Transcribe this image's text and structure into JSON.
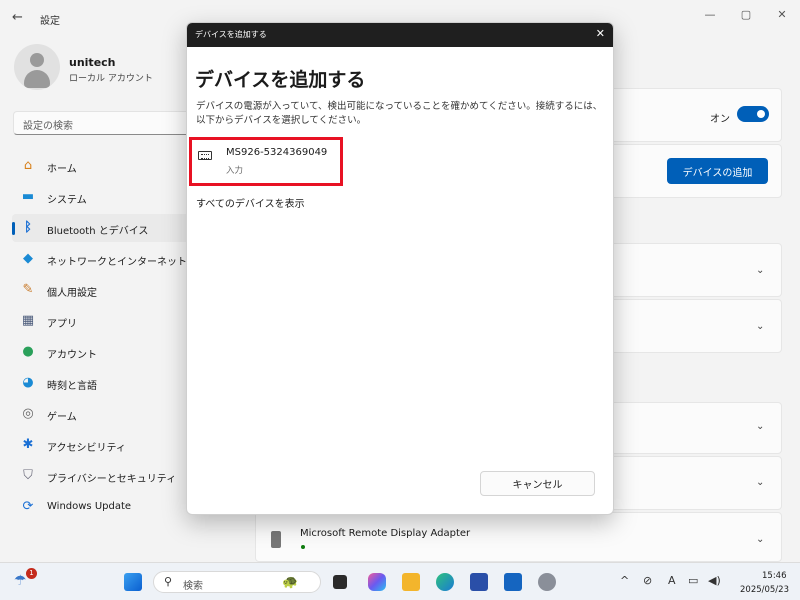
{
  "app": {
    "title": "設定",
    "window_controls": [
      "—",
      "▢",
      "✕"
    ]
  },
  "profile": {
    "name": "unitech",
    "account_type": "ローカル アカウント"
  },
  "search": {
    "placeholder": "設定の検索"
  },
  "sidebar": {
    "items": [
      {
        "label": "ホーム",
        "icon": "home-icon",
        "glyph": "⌂",
        "color": "#d7801a"
      },
      {
        "label": "システム",
        "icon": "system-icon",
        "glyph": "▬",
        "color": "#1a8ad4"
      },
      {
        "label": "Bluetooth とデバイス",
        "icon": "bluetooth-icon",
        "glyph": "ᛒ",
        "color": "#1a6fd4",
        "active": true
      },
      {
        "label": "ネットワークとインターネット",
        "icon": "network-icon",
        "glyph": "◆",
        "color": "#1a8ad4"
      },
      {
        "label": "個人用設定",
        "icon": "brush-icon",
        "glyph": "✎",
        "color": "#c87a2a"
      },
      {
        "label": "アプリ",
        "icon": "apps-icon",
        "glyph": "▦",
        "color": "#4a5a7a"
      },
      {
        "label": "アカウント",
        "icon": "account-icon",
        "glyph": "●",
        "color": "#2aa05a"
      },
      {
        "label": "時刻と言語",
        "icon": "time-language-icon",
        "glyph": "◕",
        "color": "#1a8ad4"
      },
      {
        "label": "ゲーム",
        "icon": "gaming-icon",
        "glyph": "◎",
        "color": "#666666"
      },
      {
        "label": "アクセシビリティ",
        "icon": "accessibility-icon",
        "glyph": "✱",
        "color": "#1a6fd4"
      },
      {
        "label": "プライバシーとセキュリティ",
        "icon": "shield-icon",
        "glyph": "⛉",
        "color": "#6a6a7a"
      },
      {
        "label": "Windows Update",
        "icon": "update-icon",
        "glyph": "⟳",
        "color": "#1a6fd4"
      }
    ]
  },
  "main": {
    "bluetooth_toggle_label": "オン",
    "bluetooth_on": true,
    "add_device_button": "デバイスの追加",
    "remote_adapter": "Microsoft Remote Display Adapter"
  },
  "dialog": {
    "titlebar": "デバイスを追加する",
    "heading": "デバイスを追加する",
    "description": "デバイスの電源が入っていて、検出可能になっていることを確かめてください。接続するには、以下からデバイスを選択してください。",
    "devices": [
      {
        "name": "MS926-5324369049",
        "type": "入力",
        "icon": "keyboard-icon"
      }
    ],
    "show_all_link": "すべてのデバイスを表示",
    "cancel_button": "キャンセル"
  },
  "taskbar": {
    "notification_count": "1",
    "search_label": "検索",
    "clock_time": "15:46",
    "clock_date": "2025/05/23",
    "tray_glyphs": {
      "chevron": "^",
      "ime": "A"
    }
  },
  "colors": {
    "accent": "#005fb8",
    "highlight_border": "#e81123"
  }
}
